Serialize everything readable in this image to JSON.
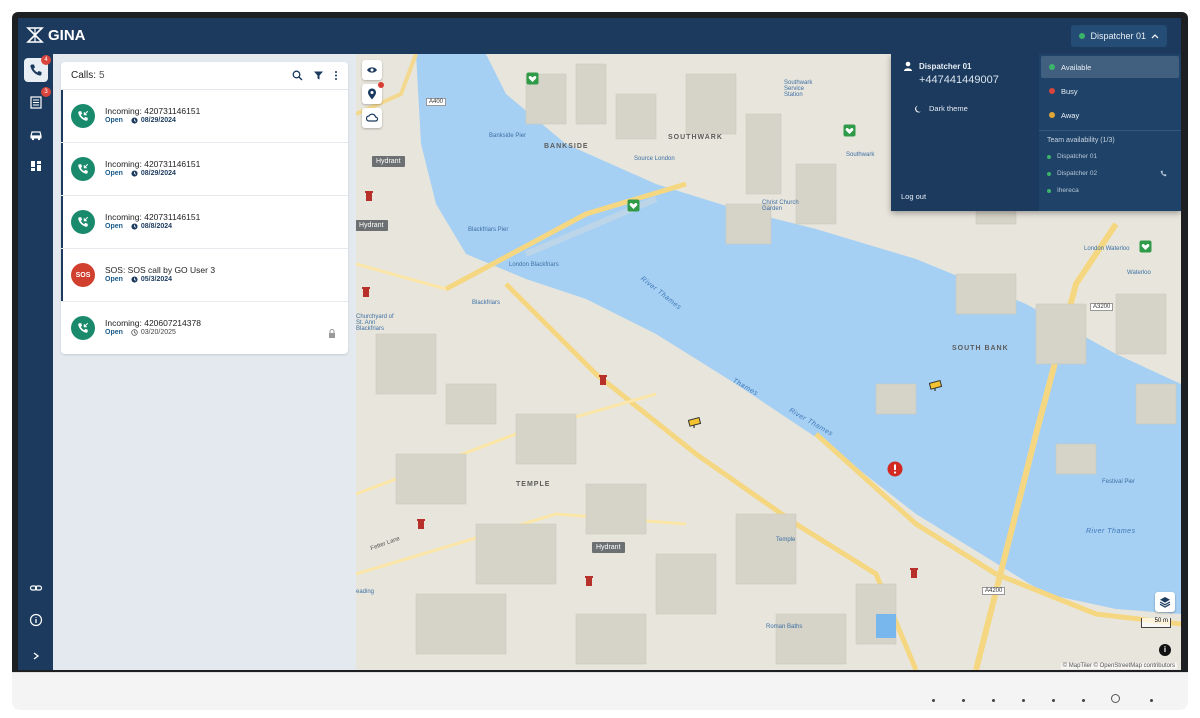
{
  "app": {
    "name": "GINA"
  },
  "topbar": {
    "dispatcher_label": "Dispatcher 01",
    "status_color": "#3bb36a"
  },
  "rail": {
    "calls_badge": "4",
    "tasks_badge": "3"
  },
  "calls": {
    "header_label": "Calls:",
    "count": "5",
    "items": [
      {
        "title": "Incoming: 420731146151",
        "status": "Open",
        "date": "08/29/2024",
        "type": "incoming"
      },
      {
        "title": "Incoming: 420731146151",
        "status": "Open",
        "date": "08/29/2024",
        "type": "incoming"
      },
      {
        "title": "Incoming: 420731146151",
        "status": "Open",
        "date": "08/8/2024",
        "type": "incoming"
      },
      {
        "title": "SOS: SOS call by GO User 3",
        "status": "Open",
        "date": "05/3/2024",
        "type": "sos",
        "avatar_text": "SOS"
      },
      {
        "title": "Incoming: 420607214378",
        "status": "Open",
        "date": "03/20/2025",
        "type": "incoming"
      }
    ]
  },
  "colors": {
    "incoming": "#1a8a6c",
    "sos": "#d1402f",
    "brand": "#1b3a5e"
  },
  "dropdown": {
    "user_name": "Dispatcher 01",
    "phone": "+447441449007",
    "dark_theme_label": "Dark theme",
    "logout_label": "Log out",
    "statuses": [
      {
        "label": "Available",
        "color": "#3bb36a",
        "selected": true
      },
      {
        "label": "Busy",
        "color": "#d9453d"
      },
      {
        "label": "Away",
        "color": "#e0a537"
      }
    ],
    "team_title": "Team availability (1/3)",
    "team": [
      {
        "name": "Dispatcher 01",
        "color": "#3bb36a"
      },
      {
        "name": "Dispatcher 02",
        "color": "#3bb36a"
      },
      {
        "name": "Ihereca",
        "color": "#3bb36a"
      }
    ]
  },
  "map": {
    "labels": {
      "bankside": "BANKSIDE",
      "southwark": "SOUTHWARK",
      "south_bank": "SOUTH BANK",
      "temple": "TEMPLE",
      "river1": "River Thames",
      "river2": "River Thames",
      "river3": "River Thames",
      "river4": "Thames",
      "blackfriars_pier": "Blackfriars Pier",
      "london_blackfriars": "London Blackfriars",
      "blackfriars": "Blackfriars",
      "bankside_pier": "Bankside Pier",
      "temple_station": "Temple",
      "festival_pier": "Festival Pier",
      "roman_baths": "Roman Baths",
      "london_waterloo": "London Waterloo",
      "waterloo": "Waterloo",
      "christ_church": "Christ Church Garden",
      "southwark_station": "Southwark",
      "source_london": "Source London",
      "a4200": "A4200",
      "a3200": "A3200",
      "a400": "A400",
      "fetter_lane": "Fetter Lane",
      "st_andrew": "Churchyard of St. Ann Blackfriars",
      "reading": "eading",
      "swimming": "Southwark Service Station"
    },
    "hydrant_label": "Hydrant",
    "scale_label": "50 m",
    "attribution": "© MapTiler © OpenStreetMap contributors"
  }
}
